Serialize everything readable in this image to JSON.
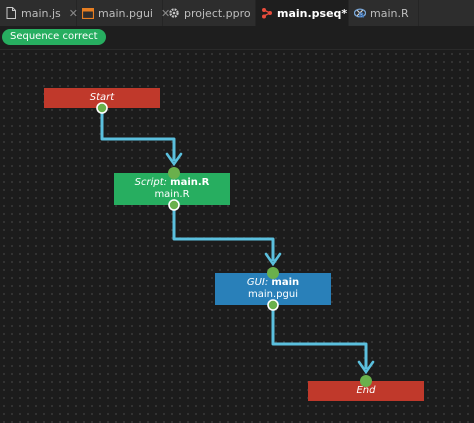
{
  "tabs": [
    {
      "label": "main.js",
      "icon": "document-icon",
      "active": false
    },
    {
      "label": "main.pgui",
      "icon": "window-icon",
      "active": false
    },
    {
      "label": "project.ppro",
      "icon": "gear-icon",
      "active": false
    },
    {
      "label": "main.pseq*",
      "icon": "sequence-icon",
      "active": true
    },
    {
      "label": "main.R",
      "icon": "r-logo-icon",
      "active": false
    }
  ],
  "close_glyph": "✕",
  "status": {
    "label": "Sequence correct",
    "color": "#27ae60"
  },
  "nodes": {
    "start": {
      "label": "Start",
      "color": "#c0392b"
    },
    "script": {
      "kind": "Script:",
      "name": "main.R",
      "file": "main.R",
      "color": "#27ae60"
    },
    "gui": {
      "kind": "GUI:",
      "name": "main",
      "file": "main.pgui",
      "color": "#2980b9"
    },
    "end": {
      "label": "End",
      "color": "#c0392b"
    }
  },
  "colors": {
    "connector": "#5bc0de",
    "port": "#6ab04c",
    "background": "#1e1e1e"
  }
}
